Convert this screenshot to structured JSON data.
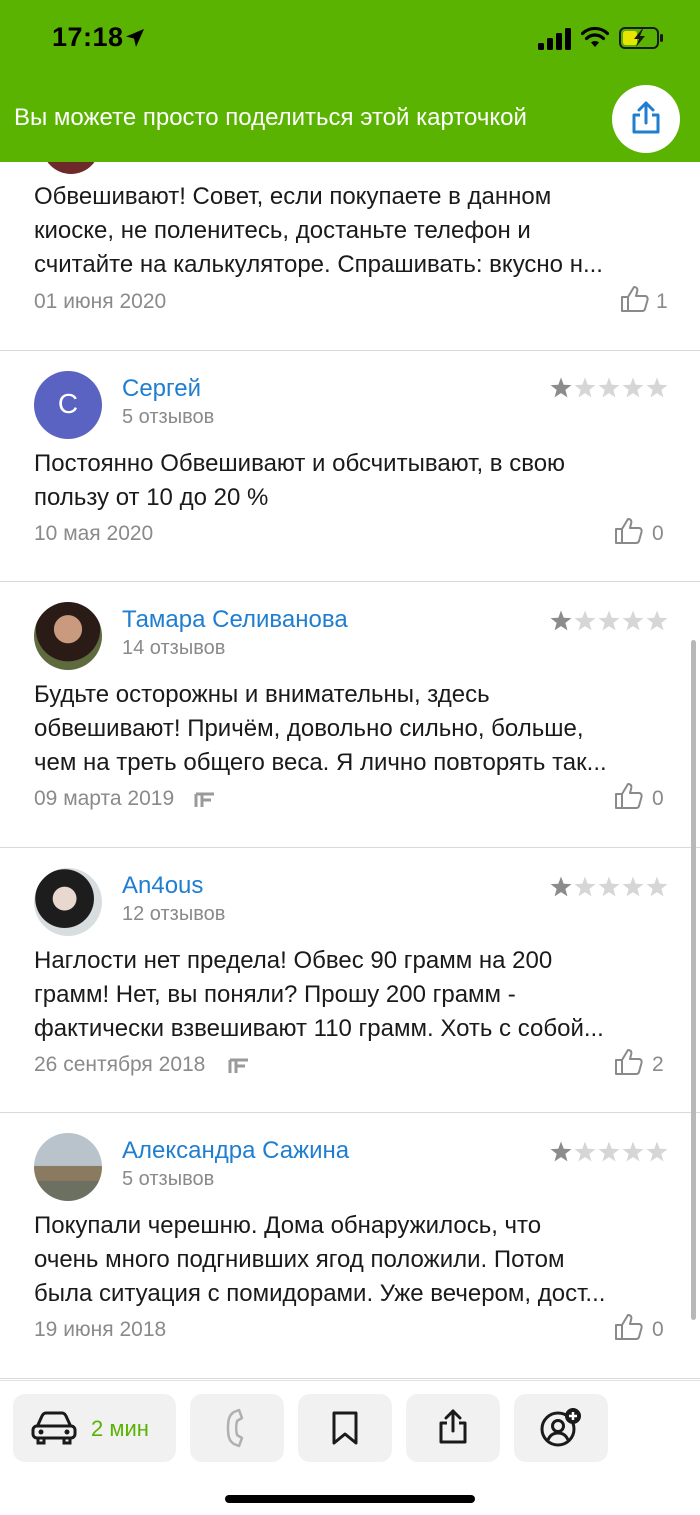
{
  "status_bar": {
    "time": "17:18"
  },
  "share_banner": {
    "text": "Вы можете просто поделиться этой карточкой",
    "share_icon": "share-icon"
  },
  "colors": {
    "brand_green": "#5ab300",
    "link_blue": "#1f7ed0",
    "muted": "#8a8a8a",
    "star_filled": "#8c8c8c",
    "star_empty": "#d6d6d6"
  },
  "reviews": [
    {
      "name": "",
      "count": "",
      "rating": 1,
      "text": [
        "Обвешивают! Совет, если покупаете в данном",
        "киоске, не поленитесь, достаньте телефон и",
        "считайте на калькуляторе. Спрашивать: вкусно н..."
      ],
      "date": "01 июня 2020",
      "likes": "1"
    },
    {
      "name": "Сергей",
      "avatar_letter": "С",
      "count": "5 отзывов",
      "rating": 1,
      "text": [
        "Постоянно Обвешивают и обсчитывают, в свою",
        "пользу от 10 до 20 %"
      ],
      "date": "10 мая 2020",
      "likes": "0"
    },
    {
      "name": "Тамара Селиванова",
      "count": "14 отзывов",
      "rating": 1,
      "text": [
        "Будьте осторожны и внимательны, здесь",
        "обвешивают! Причём, довольно сильно, больше,",
        "чем на треть общего веса. Я лично повторять так..."
      ],
      "date": "09 марта 2019",
      "likes": "0"
    },
    {
      "name": "An4ous",
      "count": "12 отзывов",
      "rating": 1,
      "text": [
        "Наглости нет предела! Обвес 90 грамм на 200",
        "грамм! Нет, вы поняли? Прошу 200 грамм -",
        "фактически взвешивают 110 грамм. Хоть с собой..."
      ],
      "date": "26 сентября 2018",
      "likes": "2"
    },
    {
      "name": "Александра Сажина",
      "count": "5 отзывов",
      "rating": 1,
      "text": [
        "Покупали черешню. Дома обнаружилось, что",
        "очень много подгнивших ягод положили. Потом",
        "была ситуация с помидорами. Уже вечером, дост..."
      ],
      "date": "19 июня 2018",
      "likes": "0"
    }
  ],
  "bottom_bar": {
    "route_label": "2 мин",
    "icons": [
      "car-icon",
      "phone-icon",
      "bookmark-icon",
      "share-icon",
      "add-friend-icon"
    ]
  }
}
